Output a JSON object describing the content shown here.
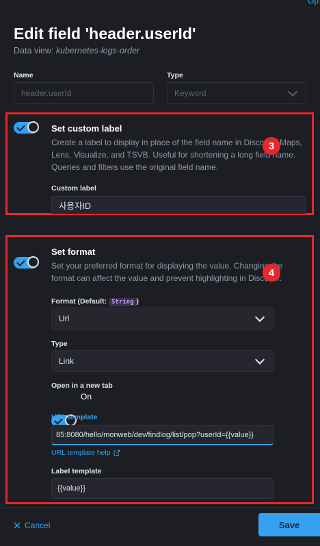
{
  "top_link": "Op",
  "header": {
    "title": "Edit field 'header.userId'",
    "subtitle_prefix": "Data view: ",
    "subtitle_view": "kubernetes-logs-order"
  },
  "name_field": {
    "label": "Name",
    "value": "header.userId"
  },
  "type_field": {
    "label": "Type",
    "value": "Keyword"
  },
  "custom_label_section": {
    "title": "Set custom label",
    "description": "Create a label to display in place of the field name in Discover, Maps, Lens, Visualize, and TSVB. Useful for shortening a long field name. Queries and filters use the original field name.",
    "input_label": "Custom label",
    "input_value": "사용자ID",
    "badge": "3"
  },
  "format_section": {
    "title": "Set format",
    "description": "Set your preferred format for displaying the value. Changing the format can affect the value and prevent highlighting in Discover.",
    "badge": "4",
    "format_label": "Format (Default: ",
    "format_default": "String",
    "format_label_close": ")",
    "format_value": "Url",
    "type_label": "Type",
    "type_value": "Link",
    "new_tab_label": "Open in a new tab",
    "new_tab_state": "On",
    "url_template_label": "URL template",
    "url_template_value": "85:8080/hello/monweb/dev/findlog/list/pop?userId={{value}}",
    "url_template_help": "URL template help",
    "label_template_label": "Label template",
    "label_template_value": "{{value}}"
  },
  "footer": {
    "cancel": "Cancel",
    "save": "Save"
  },
  "colors": {
    "accent": "#36a2ef",
    "annotation": "#e8262c",
    "background": "#1d1e24"
  }
}
